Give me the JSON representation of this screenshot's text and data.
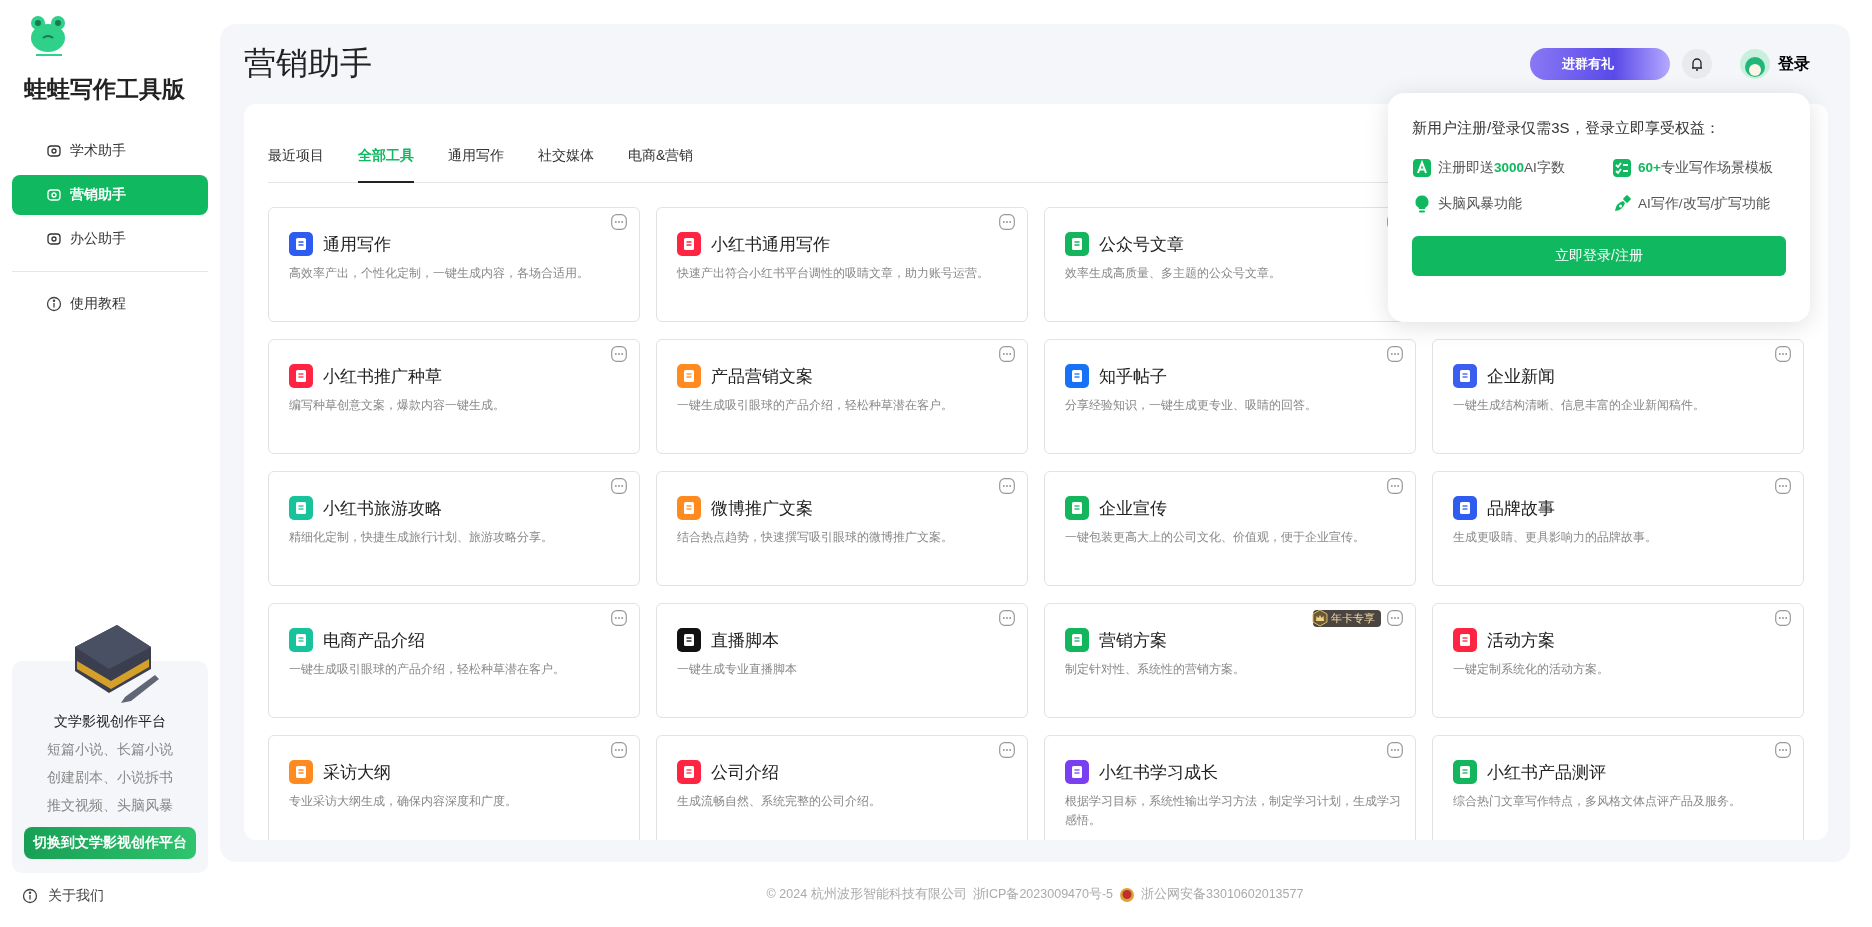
{
  "app": {
    "name": "蛙蛙写作工具版"
  },
  "sidebar": {
    "items": [
      {
        "label": "学术助手",
        "selected": false
      },
      {
        "label": "营销助手",
        "selected": true
      },
      {
        "label": "办公助手",
        "selected": false
      }
    ],
    "help": "使用教程",
    "promo": {
      "title": "文学影视创作平台",
      "lines": [
        "短篇小说、长篇小说",
        "创建剧本、小说拆书",
        "推文视频、头脑风暴"
      ],
      "button": "切换到文学影视创作平台"
    },
    "about": "关于我们"
  },
  "header": {
    "title": "营销助手",
    "gift": "进群有礼",
    "login": "登录"
  },
  "tabs": [
    {
      "label": "最近项目",
      "selected": false
    },
    {
      "label": "全部工具",
      "selected": true
    },
    {
      "label": "通用写作",
      "selected": false
    },
    {
      "label": "社交媒体",
      "selected": false
    },
    {
      "label": "电商&营销",
      "selected": false
    }
  ],
  "card_rows": [
    [
      {
        "title": "通用写作",
        "description": "高效率产出，个性化定制，一键生成内容，各场合适用。",
        "color": "#2f5cf0"
      },
      {
        "title": "小红书通用写作",
        "description": "快速产出符合小红书平台调性的吸睛文章，助力账号运营。",
        "color": "#ff2442"
      },
      {
        "title": "公众号文章",
        "description": "效率生成高质量、多主题的公众号文章。",
        "color": "#13b55d"
      }
    ],
    [
      {
        "title": "小红书推广种草",
        "description": "编写种草创意文案，爆款内容一键生成。",
        "color": "#ff2442"
      },
      {
        "title": "产品营销文案",
        "description": "一键生成吸引眼球的产品介绍，轻松种草潜在客户。",
        "color": "#ff8a1f"
      },
      {
        "title": "知乎帖子",
        "description": "分享经验知识，一键生成更专业、吸睛的回答。",
        "color": "#1772f6"
      },
      {
        "title": "企业新闻",
        "description": "一键生成结构清晰、信息丰富的企业新闻稿件。",
        "color": "#3a5ef0"
      }
    ],
    [
      {
        "title": "小红书旅游攻略",
        "description": "精细化定制，快捷生成旅行计划、旅游攻略分享。",
        "color": "#17c39a"
      },
      {
        "title": "微博推广文案",
        "description": "结合热点趋势，快速撰写吸引眼球的微博推广文案。",
        "color": "#ff8a1f"
      },
      {
        "title": "企业宣传",
        "description": "一键包装更高大上的公司文化、价值观，便于企业宣传。",
        "color": "#13b55d"
      },
      {
        "title": "品牌故事",
        "description": "生成更吸睛、更具影响力的品牌故事。",
        "color": "#2f5cf0"
      }
    ],
    [
      {
        "title": "电商产品介绍",
        "description": "一键生成吸引眼球的产品介绍，轻松种草潜在客户。",
        "color": "#17c39a"
      },
      {
        "title": "直播脚本",
        "description": "一键生成专业直播脚本",
        "color": "#111111"
      },
      {
        "title": "营销方案",
        "description": "制定针对性、系统性的营销方案。",
        "color": "#13b55d",
        "badge": "年卡专享"
      },
      {
        "title": "活动方案",
        "description": "一键定制系统化的活动方案。",
        "color": "#ff2442"
      }
    ],
    [
      {
        "title": "采访大纲",
        "description": "专业采访大纲生成，确保内容深度和广度。",
        "color": "#ff8a1f"
      },
      {
        "title": "公司介绍",
        "description": "生成流畅自然、系统完整的公司介绍。",
        "color": "#ff2442"
      },
      {
        "title": "小红书学习成长",
        "description": "根据学习目标，系统性输出学习方法，制定学习计划，生成学习感悟。",
        "color": "#7b3ff2"
      },
      {
        "title": "小红书产品测评",
        "description": "综合热门文章写作特点，多风格文体点评产品及服务。",
        "color": "#13b55d"
      }
    ]
  ],
  "popup": {
    "title": "新用户注册/登录仅需3S，登录立即享受权益：",
    "features": [
      "注册即送**3000**AI字数",
      "**60+**专业写作场景模板",
      "头脑风暴功能",
      "AI写作/改写/扩写功能"
    ],
    "button": "立即登录/注册"
  },
  "footer": {
    "copyright": "© 2024 杭州波形智能科技有限公司",
    "icp": "浙ICP备2023009470号-5",
    "police": "浙公网安备33010602013577"
  }
}
